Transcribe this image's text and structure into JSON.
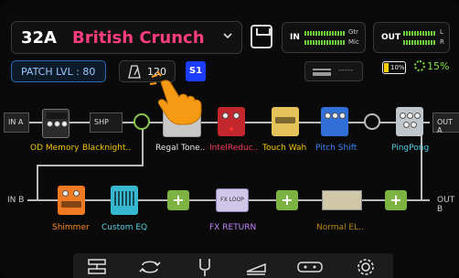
{
  "header": {
    "preset_number": "32A",
    "preset_name": "British Crunch",
    "meter_in": {
      "label": "IN",
      "ch1": "Gtr",
      "ch2": "Mic"
    },
    "meter_out": {
      "label": "OUT",
      "ch1": "L",
      "ch2": "R"
    }
  },
  "status": {
    "patch_level": "PATCH LVL : 80",
    "tempo": "120",
    "scene": "S1",
    "slot_placeholder": "-----",
    "battery": "10%",
    "cpu": "15%"
  },
  "chain": {
    "in_a": "IN A",
    "in_b": "IN B",
    "out_a": "OUT A",
    "out_b": "OUT B",
    "row_a": [
      {
        "label": "OD Memory",
        "color": "#f5c400"
      },
      {
        "label": "Blacknight..",
        "color": "#f5c400"
      },
      {
        "label": "Regal Tone..",
        "color": "#e8e8e8"
      },
      {
        "label": "IntelReduc..",
        "color": "#ff3b5c"
      },
      {
        "label": "Touch Wah",
        "color": "#f5c400"
      },
      {
        "label": "Pitch Shift",
        "color": "#3b82f6"
      },
      {
        "label": "PingPong",
        "color": "#4fd1e8"
      }
    ],
    "row_b": [
      {
        "label": "Shimmer",
        "color": "#ff8a1f"
      },
      {
        "label": "Custom EQ",
        "color": "#4fd1e8"
      },
      {
        "label": "FX RETURN",
        "color": "#c084fc"
      },
      {
        "label": "Normal EL..",
        "color": "#b8860b"
      }
    ],
    "box_labels": {
      "bk_amp": "SHP",
      "fx_loop": "FX LOOP"
    }
  },
  "toolbar": {
    "icons": [
      "routing-icon",
      "loop-icon",
      "tuner-icon",
      "slope-icon",
      "cab-icon",
      "settings-icon"
    ]
  }
}
